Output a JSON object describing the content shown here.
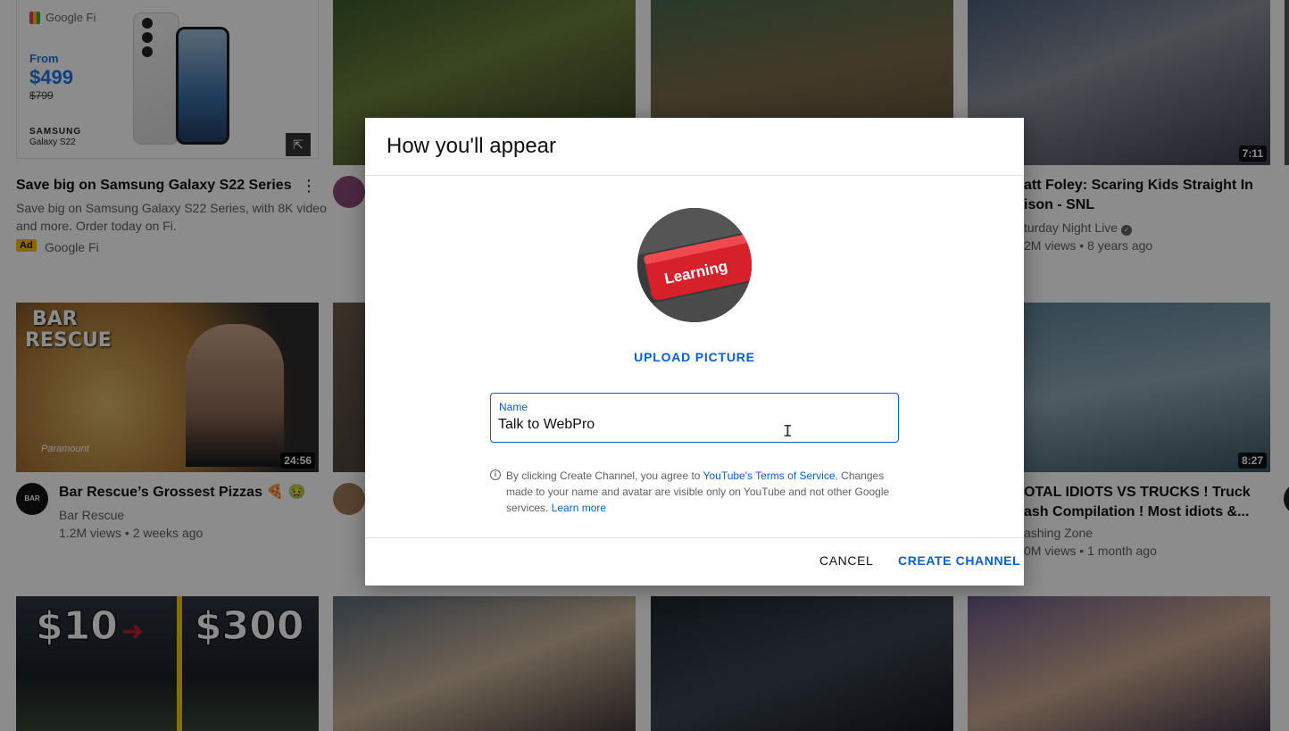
{
  "feed": {
    "ad": {
      "brand": "Google Fi",
      "from": "From",
      "price": "$499",
      "old_price": "$799",
      "maker": "SAMSUNG",
      "model": "Galaxy S22",
      "title": "Save big on Samsung Galaxy S22 Series",
      "description_line1": "Save big on Samsung Galaxy S22 Series, with 8K video",
      "description_line2": "and more. Order today on Fi.",
      "badge": "Ad",
      "advertiser": "Google Fi"
    },
    "video_snl": {
      "duration": "7:11",
      "title_line1": "att Foley: Scaring Kids Straight In",
      "title_line2": "ison - SNL",
      "channel": "turday Night Live",
      "meta": "2M views • 8 years ago"
    },
    "video_bar": {
      "thumb_text1": "BAR",
      "thumb_text2": "RESCUE",
      "thumb_network": "Paramount",
      "duration": "24:56",
      "title": "Bar Rescue’s Grossest Pizzas 🍕 🤢",
      "channel": "Bar Rescue",
      "meta": "1.2M views • 2 weeks ago"
    },
    "video_trucks": {
      "duration": "8:27",
      "title_line1": "OTAL IDIOTS VS TRUCKS ! Truck",
      "title_line2": "ash Compilation ! Most idiots &...",
      "channel": "ashing Zone",
      "meta": "0M views • 1 month ago"
    },
    "video_keyboard": {
      "thumb_left": "$10",
      "thumb_right": "$300"
    }
  },
  "dialog": {
    "title": "How you'll appear",
    "avatar_text": "Learning",
    "upload_label": "UPLOAD PICTURE",
    "name_label": "Name",
    "name_value": "Talk to WebPro",
    "disclaimer_prefix": "By clicking Create Channel, you agree to ",
    "tos_link": "YouTube's Terms of Service",
    "disclaimer_mid": ". Changes made to your name and avatar are visible only on YouTube and not other Google services. ",
    "learn_more": "Learn more",
    "cancel_label": "CANCEL",
    "create_label": "CREATE CHANNEL"
  },
  "colors": {
    "accent": "#065fd4",
    "scrim": "rgba(0,0,0,0.45)"
  },
  "icons": [
    "info-icon",
    "external-link-icon",
    "more-vert-icon",
    "verified-icon",
    "text-cursor-icon"
  ]
}
